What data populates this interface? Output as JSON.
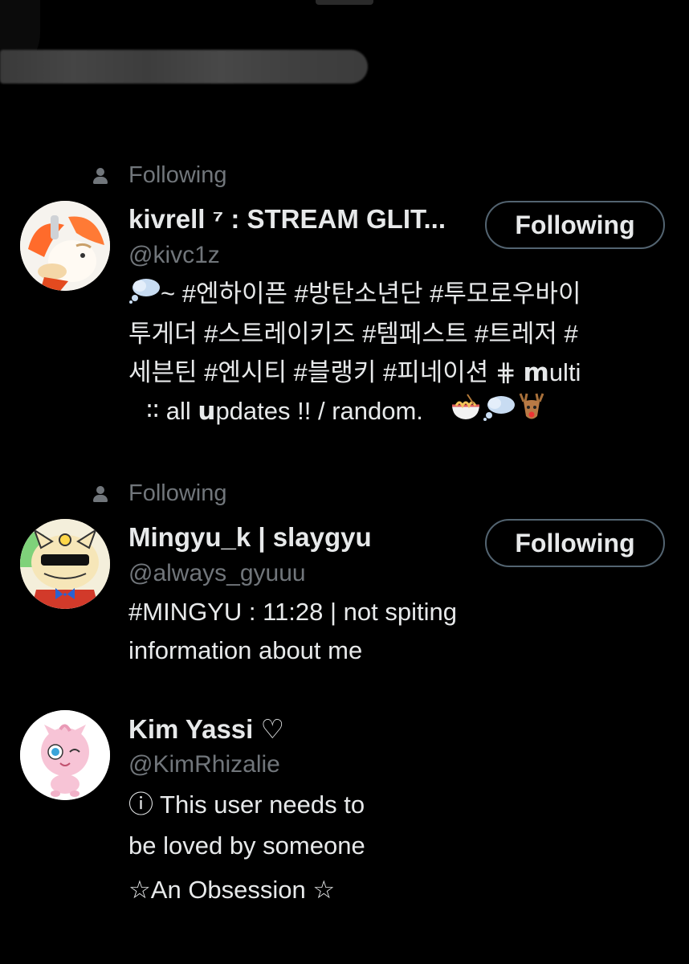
{
  "users": [
    {
      "context": "Following",
      "name": "kivrell ⁷ : STREAM GLIT...",
      "handle": "@kivc1z",
      "button": "Following",
      "bio_lines": [
        "~ #엔하이픈 #방탄소년단 #투모로우바이",
        "투게더 #스트레이키즈 #템페스트 #트레저 #",
        "세븐틴 #엔시티 #블랭키 #피네이션 ⋕  𝗺ulti",
        "∶∶  all 𝘂pdates !! / random."
      ],
      "bio_icons": [
        "thought-bubble-icon",
        "ramen-bowl-icon",
        "thought-bubble-icon",
        "deer-icon"
      ]
    },
    {
      "context": "Following",
      "name": "Mingyu_k | slaygyu",
      "handle": "@always_gyuuu",
      "button": "Following",
      "bio_lines": [
        "#MINGYU : 11:28 | not spiting",
        "information about me"
      ]
    },
    {
      "name": "Kim Yassi ♡",
      "handle": "@KimRhizalie",
      "bio_lines": [
        "ⓘ  This user needs to",
        "be loved by someone",
        "☆An Obsession ☆"
      ]
    }
  ],
  "colors": {
    "background": "#000000",
    "primary_text": "#e7e9ea",
    "secondary_text": "#71767b",
    "button_border": "#536471"
  }
}
